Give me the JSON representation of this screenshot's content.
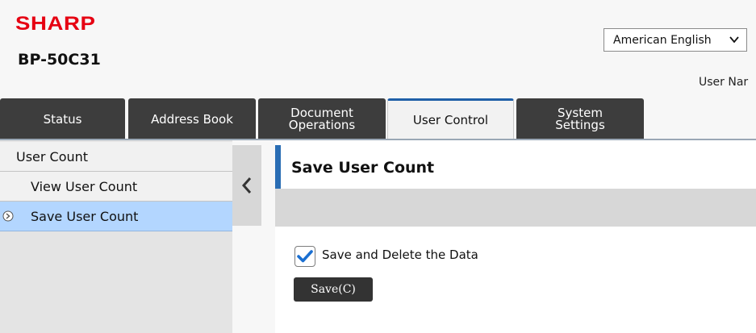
{
  "header": {
    "brand": "SHARP",
    "model": "BP-50C31",
    "language": "American English",
    "username_label": "User Nar"
  },
  "tabs": [
    {
      "label": "Status",
      "active": false
    },
    {
      "label": "Address Book",
      "active": false
    },
    {
      "label": "Document Operations",
      "line1": "Document",
      "line2": "Operations",
      "active": false
    },
    {
      "label": "User Control",
      "active": true
    },
    {
      "label": "System Settings",
      "line1": "System",
      "line2": "Settings",
      "active": false
    }
  ],
  "sidebar": {
    "items": [
      {
        "label": "User Count",
        "level": 1,
        "selected": false
      },
      {
        "label": "View User Count",
        "level": 2,
        "selected": false
      },
      {
        "label": "Save User Count",
        "level": 2,
        "selected": true
      }
    ]
  },
  "main": {
    "title": "Save User Count",
    "checkbox_label": "Save and Delete the Data",
    "checkbox_checked": true,
    "save_button": "Save(C)"
  },
  "colors": {
    "brand": "#e60012",
    "tab_bg": "#3d3d3d",
    "accent": "#2a6db4",
    "selected_bg": "#b3d6ff"
  },
  "icons": {
    "language_dropdown": "chevron-down-icon",
    "collapse": "chevron-left-icon",
    "selected_bullet": "circle-arrow-right-icon",
    "checkbox": "check-icon"
  }
}
